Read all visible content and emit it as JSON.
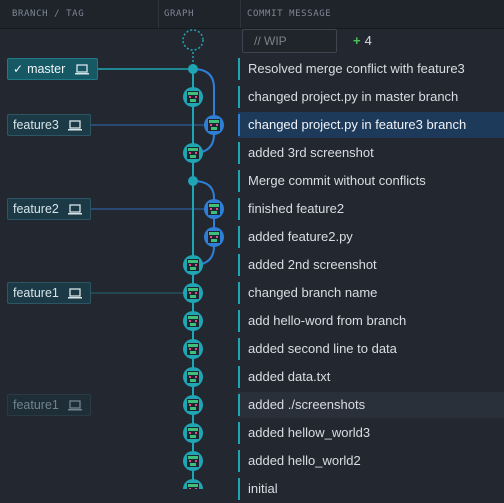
{
  "header": {
    "branch_col": "BRANCH / TAG",
    "graph_col": "GRAPH",
    "message_col": "COMMIT MESSAGE"
  },
  "wip": {
    "placeholder": "// WIP",
    "added_count": "4",
    "plus_glyph": "+"
  },
  "branches": {
    "master": "master",
    "feature3": "feature3",
    "feature2": "feature2",
    "feature1": "feature1",
    "feature1_remote": "feature1",
    "checkmark": "✓"
  },
  "commits": [
    "Resolved merge conflict with feature3",
    "changed project.py in master branch",
    "changed project.py in feature3 branch",
    "added 3rd screenshot",
    "Merge commit without conflicts",
    "finished feature2",
    "added feature2.py",
    "added 2nd screenshot",
    "changed branch name",
    "add hello-word from branch",
    "added second line to data",
    "added data.txt",
    "added ./screenshots",
    "added hellow_world3",
    "added hello_world2",
    "initial"
  ],
  "colors": {
    "teal": "#1fa5b3",
    "blue": "#2f7fd6",
    "selected_bg": "#1e3a5a"
  }
}
